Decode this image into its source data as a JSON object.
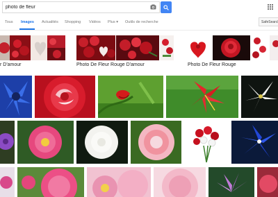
{
  "search": {
    "query": "photo de fleur"
  },
  "tabs": [
    {
      "label": "Tous"
    },
    {
      "label": "Images"
    },
    {
      "label": "Actualités"
    },
    {
      "label": "Shopping"
    },
    {
      "label": "Vidéos"
    },
    {
      "label": "Plus ▾"
    },
    {
      "label": "Outils de recherche"
    }
  ],
  "safesearch": {
    "label": "SafeSearch"
  },
  "related": [
    {
      "label": "r D'amour"
    },
    {
      "label": "Photo De Fleur Rouge D'amour"
    },
    {
      "label": "Photo De Fleur Rouge"
    }
  ],
  "colors": {
    "accent": "#4285f4",
    "active_tab": "#1a73e8"
  }
}
